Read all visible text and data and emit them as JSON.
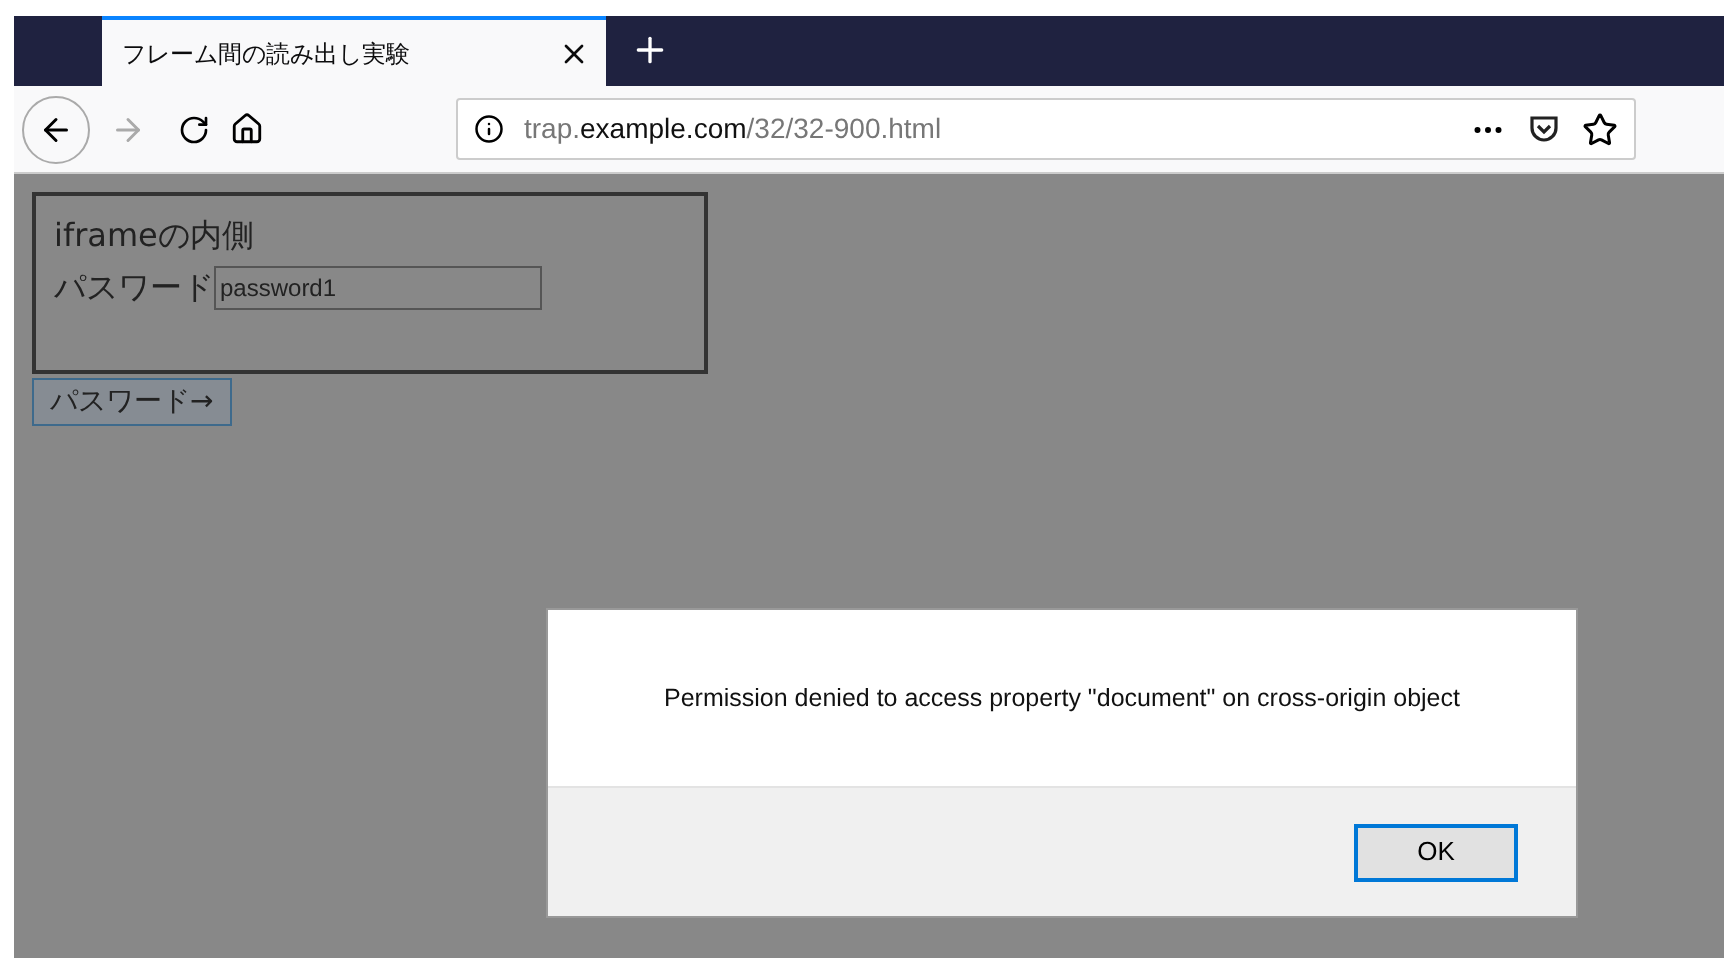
{
  "tab": {
    "title": "フレーム間の読み出し実験",
    "selected": true
  },
  "address_bar": {
    "url": "trap.**example.com**/32/32-900.html"
  },
  "iframe": {
    "heading": "iframeの内側",
    "label": "パスワード",
    "value": "password1"
  },
  "page_button": "パスワード→",
  "dialog": {
    "message": "Permission denied to access property \"document\" on cross-origin object",
    "button": "OK"
  }
}
